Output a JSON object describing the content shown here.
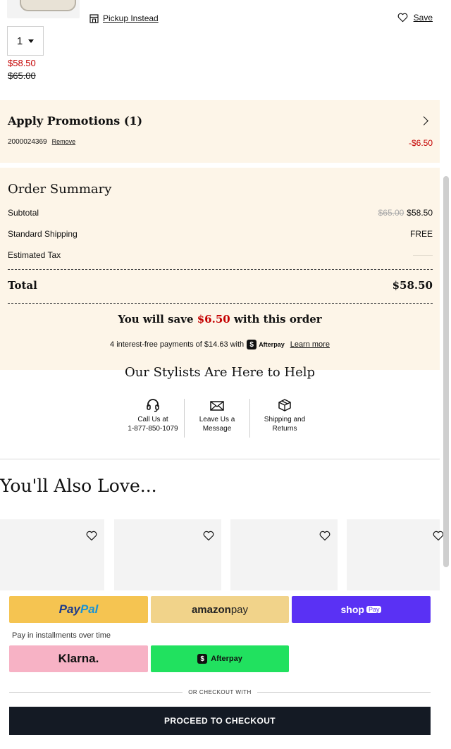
{
  "item": {
    "pickup_label": "Pickup Instead",
    "save_label": "Save",
    "quantity": "1",
    "price_now": "$58.50",
    "price_was": "$65.00"
  },
  "promotions": {
    "title": "Apply Promotions",
    "count": "(1)",
    "code": "2000024369",
    "remove_label": "Remove",
    "discount": "-$6.50"
  },
  "order_summary": {
    "title": "Order Summary",
    "subtotal_label": "Subtotal",
    "subtotal_was": "$65.00",
    "subtotal_now": "$58.50",
    "shipping_label": "Standard Shipping",
    "shipping_value": "FREE",
    "tax_label": "Estimated Tax",
    "total_label": "Total",
    "total_value": "$58.50",
    "savings_prefix": "You will save",
    "savings_amount": "$6.50",
    "savings_suffix": "with this order",
    "afterpay_text": "4 interest-free payments of $14.63 with",
    "afterpay_brand": "Afterpay",
    "learn_more": "Learn more"
  },
  "stylists": {
    "title": "Our Stylists Are Here to Help",
    "call_line1": "Call Us at",
    "call_line2": "1-877-850-1079",
    "message_line1": "Leave Us a",
    "message_line2": "Message",
    "shipping_line1": "Shipping and",
    "shipping_line2": "Returns"
  },
  "also_love": {
    "title": "You'll Also Love..."
  },
  "payments": {
    "paypal_a": "Pay",
    "paypal_b": "Pal",
    "amazon_a": "amazon",
    "amazon_b": " pay",
    "shop_label": "shop",
    "shop_tag": "Pay",
    "installments_label": "Pay in installments over time",
    "klarna_label": "Klarna.",
    "afterpay_label": "Afterpay",
    "or_label": "OR CHECKOUT WITH",
    "proceed_label": "PROCEED TO CHECKOUT"
  },
  "colors": {
    "accent_red": "#c40000",
    "promo_bg": "#fdf5e8",
    "checkout_bg": "#141a24"
  }
}
